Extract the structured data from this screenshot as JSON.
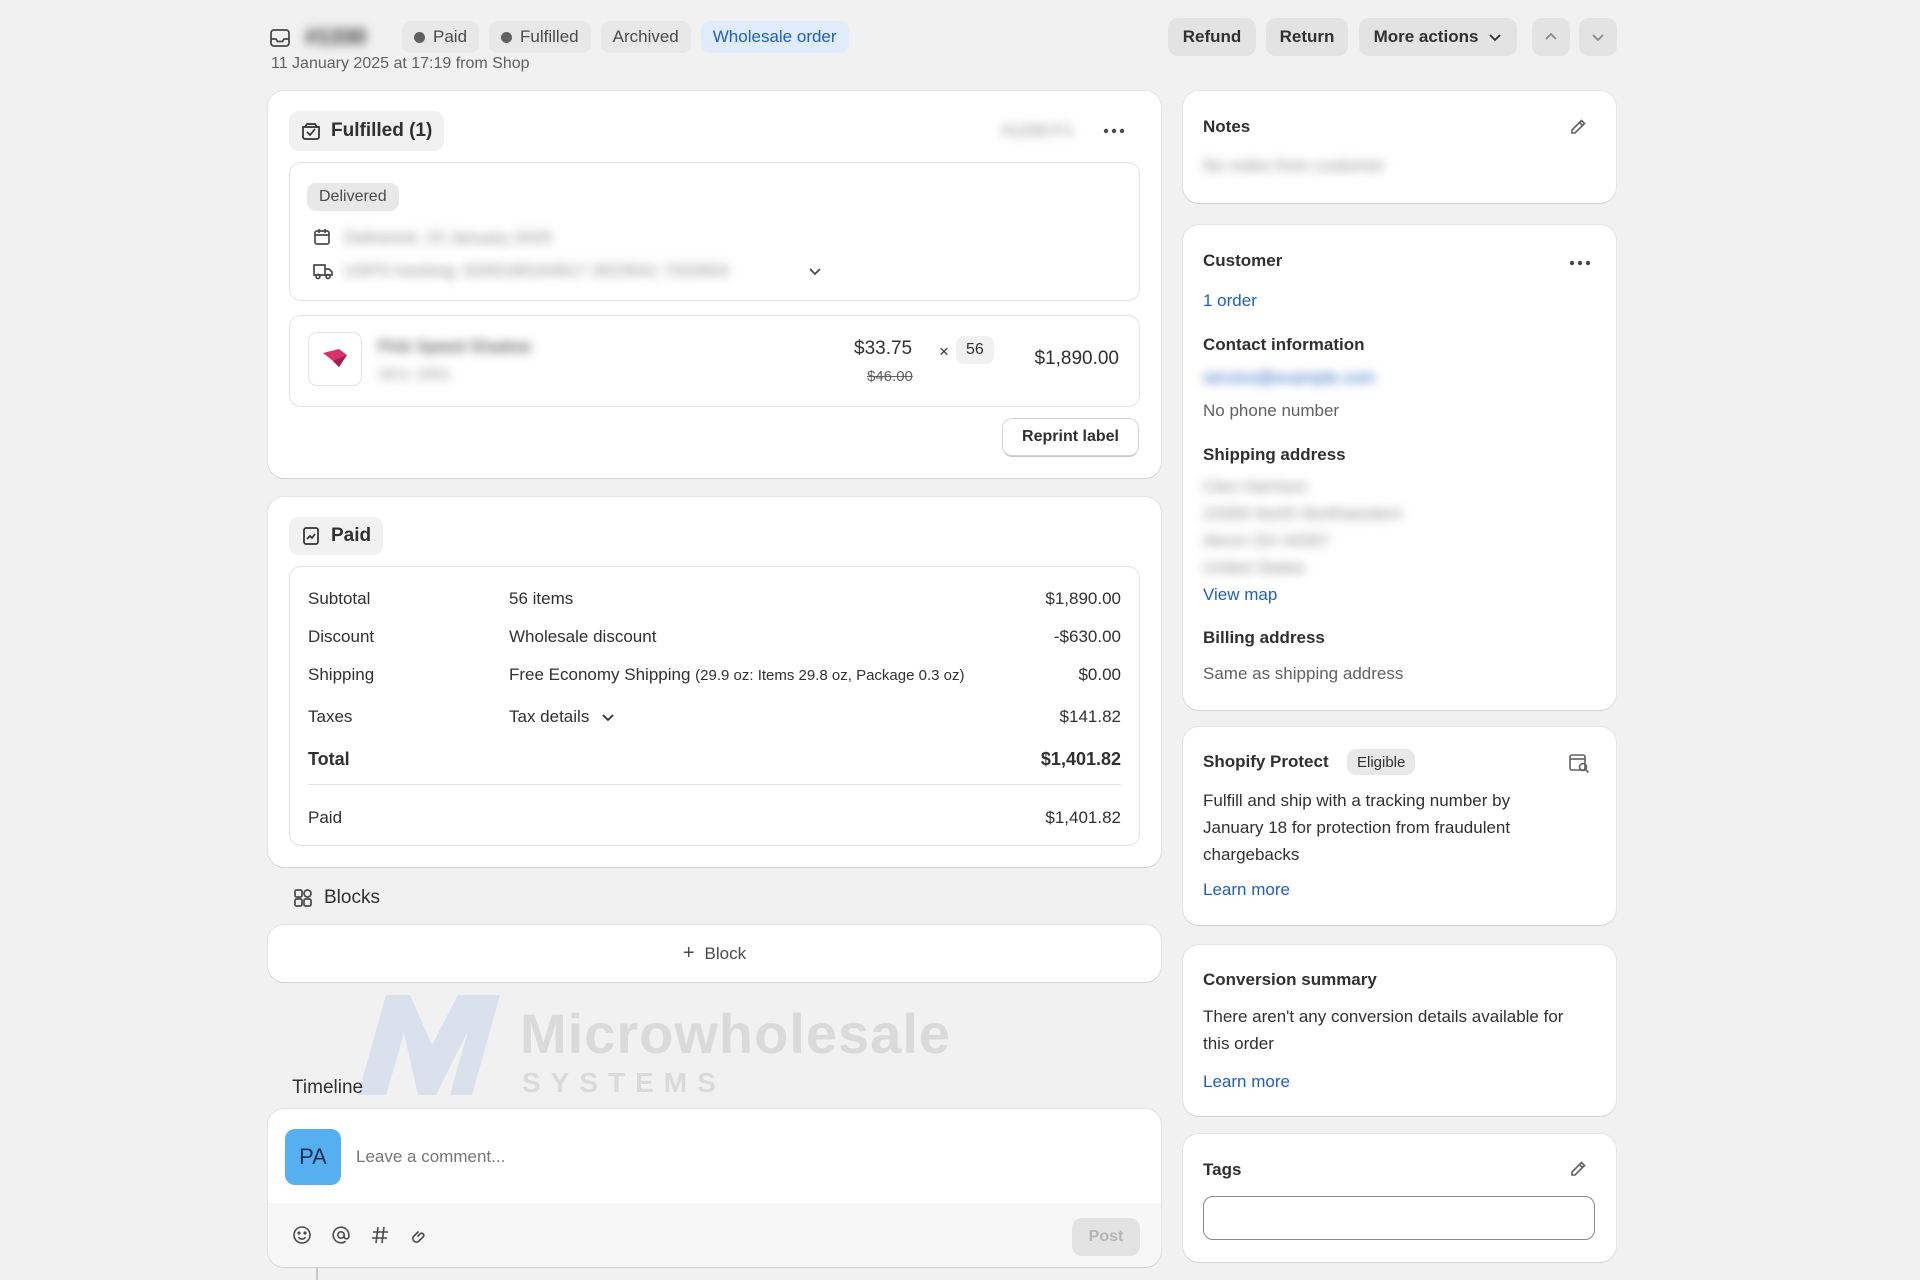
{
  "header": {
    "order_number": "#1330",
    "badges": [
      "Paid",
      "Fulfilled",
      "Archived",
      "Wholesale order"
    ],
    "subtitle": "11 January 2025 at 17:19 from Shop",
    "refund_label": "Refund",
    "return_label": "Return",
    "more_actions_label": "More actions"
  },
  "fulfilled": {
    "title": "Fulfilled (1)",
    "fulfillment_id": "#1330-F1",
    "status": "Delivered",
    "delivered_date": "Delivered, 15 January 2025",
    "tracking": "USPS tracking: 9200190164917 3023541 7332604",
    "product_name": "Pink Speed Shadow",
    "product_sku": "SKU: 2001",
    "price": "$33.75",
    "original_price": "$46.00",
    "times": "×",
    "quantity": "56",
    "line_total": "$1,890.00",
    "reprint_label": "Reprint label"
  },
  "paid": {
    "title": "Paid",
    "rows": [
      {
        "label": "Subtotal",
        "desc": "56 items",
        "amount": "$1,890.00"
      },
      {
        "label": "Discount",
        "desc": "Wholesale discount",
        "amount": "-$630.00"
      },
      {
        "label": "Shipping",
        "desc": "Free Economy Shipping",
        "desc_small": "(29.9 oz: Items 29.8 oz, Package 0.3 oz)",
        "amount": "$0.00"
      },
      {
        "label": "Taxes",
        "desc": "Tax details",
        "amount": "$141.82"
      }
    ],
    "total_label": "Total",
    "total_amount": "$1,401.82",
    "paid_label": "Paid",
    "paid_amount": "$1,401.82"
  },
  "blocks": {
    "title": "Blocks",
    "add_label": "Block"
  },
  "watermark": {
    "brand": "Microwholesale",
    "sub": "SYSTEMS"
  },
  "timeline": {
    "title": "Timeline",
    "avatar_initials": "PA",
    "comment_placeholder": "Leave a comment...",
    "post_label": "Post"
  },
  "notes": {
    "title": "Notes",
    "text": "No notes from customer"
  },
  "customer": {
    "title": "Customer",
    "orders_link": "1 order",
    "contact_title": "Contact information",
    "email": "service@example.com",
    "phone": "No phone number",
    "shipping_title": "Shipping address",
    "address_lines": [
      "Cleo Harrison",
      "23300 North Northwestern",
      "Akron OH 44307",
      "United States"
    ],
    "view_map": "View map",
    "billing_title": "Billing address",
    "billing_text": "Same as shipping address"
  },
  "protect": {
    "title": "Shopify Protect",
    "badge": "Eligible",
    "text": "Fulfill and ship with a tracking number by January 18 for protection from fraudulent chargebacks",
    "learn_more": "Learn more"
  },
  "conversion": {
    "title": "Conversion summary",
    "text": "There aren't any conversion details available for this order",
    "learn_more": "Learn more"
  },
  "tags": {
    "title": "Tags",
    "value": ""
  },
  "colors": {
    "page_bg": "#f1f1f1",
    "link": "#1f5fbf",
    "wholesale_badge_bg": "#e0ecfb",
    "wholesale_badge_text": "#1f5fbf",
    "avatar_bg": "#55aff0",
    "product_icon": "#d6336c"
  }
}
